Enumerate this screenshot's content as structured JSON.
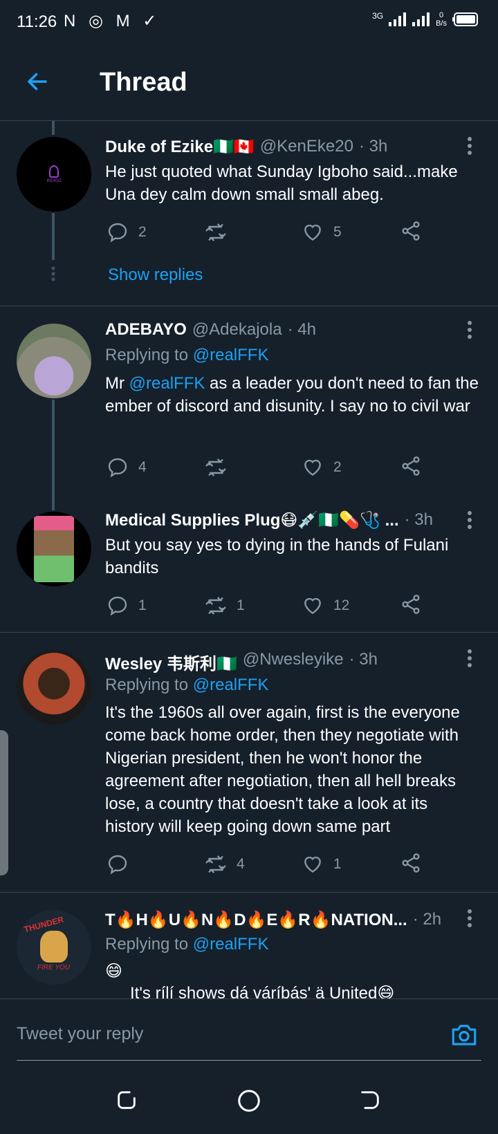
{
  "status": {
    "time": "11:26",
    "left_icons": "N ◎ M ✓",
    "network": "3G",
    "speed_value": "0",
    "speed_unit": "B/s"
  },
  "header": {
    "title": "Thread"
  },
  "tweets": [
    {
      "name": "Duke of Ezike🇳🇬🇨🇦",
      "handle": "@KenEke20",
      "time": "· 3h",
      "text": "He just quoted what Sunday Igboho said...make Una dey calm down small small abeg.",
      "replies": "2",
      "retweets": "",
      "likes": "5",
      "show_replies": "Show replies",
      "avatar_text": "INDIGO"
    },
    {
      "name": "ADEBAYO",
      "handle": "@Adekajola",
      "time": "· 4h",
      "replying_prefix": "Replying to",
      "replying_to": "@realFFK",
      "text_prefix": "Mr",
      "mention": "@realFFK",
      "text_rest": "as a leader you don't need to fan the ember of discord and disunity. I say no to civil war",
      "replies": "4",
      "retweets": "",
      "likes": "2"
    },
    {
      "name": "Medical Supplies Plug😷💉🇳🇬💊🩺 ...",
      "handle": "",
      "time": "· 3h",
      "text": "But you say yes to dying in the hands of Fulani bandits",
      "replies": "1",
      "retweets": "1",
      "likes": "12"
    },
    {
      "name": "Wesley 韦斯利🇳🇬",
      "handle": "@Nwesleyike",
      "time": "· 3h",
      "replying_prefix": "Replying to",
      "replying_to": "@realFFK",
      "text": "It's the 1960s all over again, first is the everyone come back home order, then they negotiate with Nigerian president, then he won't honor the agreement after negotiation, then all hell breaks lose, a country that doesn't take a look at its history will keep going down same part",
      "replies": "",
      "retweets": "4",
      "likes": "1"
    },
    {
      "name": "T🔥H🔥U🔥N🔥D🔥E🔥R🔥NATION...",
      "handle": "",
      "time": "· 2h",
      "replying_prefix": "Replying to",
      "replying_to": "@realFFK",
      "emoji_line": "😄",
      "text": "It's rílí shows dá váríbás' ä United😄",
      "avatar_text_top": "THUNDER",
      "avatar_text_bottom": "FIRE YOU"
    }
  ],
  "reply_bar": {
    "placeholder": "Tweet your reply"
  },
  "colors": {
    "background": "#15202b",
    "accent": "#1da1f2",
    "muted": "#8899a6",
    "divider": "#38444d"
  }
}
